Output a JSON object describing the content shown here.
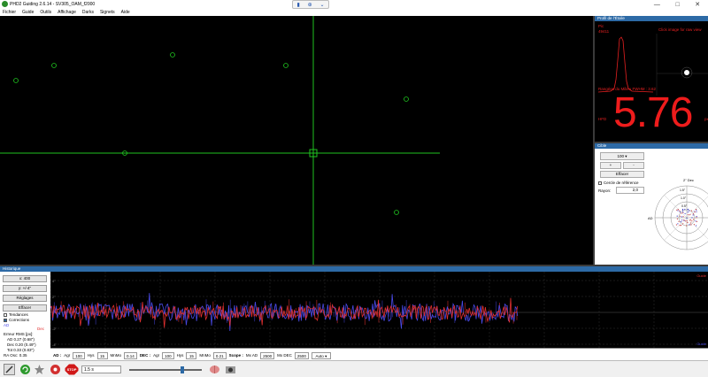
{
  "window": {
    "title": "PHD2 Guiding 2.6.14 - SV305_OAM_f2000",
    "controls": [
      "—",
      "□",
      "✕"
    ]
  },
  "menu": [
    "Fichier",
    "Guide",
    "Outils",
    "Affichage",
    "Darks",
    "Signets",
    "Aide"
  ],
  "star_profile": {
    "header": "Profil de l'Étoile",
    "peak_label": "Pic",
    "peak_value": "49411",
    "click_hint": "Click image for raw view",
    "fwhm_label": "Rangées du Milieu FWHM : 3.62",
    "hfd_label": "HFD",
    "hfd_value": "5.76",
    "hfd_unit": "px"
  },
  "target": {
    "header": "Cible",
    "zoom": "100",
    "plus": "+",
    "minus": "-",
    "clear": "Effacer",
    "ref_circle": "Cercle de référence",
    "radius_label": "Rayon:",
    "radius_value": "2,0",
    "axis_ad": "AD",
    "axis_dec": "2\" Dec",
    "ring_labels": [
      "1.5\"",
      "1.0\"",
      "0.5\""
    ]
  },
  "history": {
    "header": "Historique",
    "x_label": "x: 400",
    "y_label": "y: +/-4\"",
    "settings": "Réglages",
    "clear": "Effacer",
    "trends": "Tendances",
    "corrections": "Corrections",
    "legend_ad": "AD",
    "legend_dec": "Dec",
    "rms_title": "Erreur RMS [px]:",
    "rms_ad": "AD 0.27 (0.68\")",
    "rms_dec": "Dec 0.20 (0.49\")",
    "rms_tot": "Tot 0.33 (0.83\")",
    "osc": "RA Osc: 0.35",
    "y_ticks": [
      "4\"",
      "2\"",
      "0",
      "-2\"",
      "-4\""
    ],
    "right_top": "Guide",
    "right_bottom": "Guide"
  },
  "params": {
    "ad_label": "AD :",
    "agr_label": "Agr",
    "ad_agr": "100",
    "hys_label": "Hys",
    "ad_hys": "15",
    "mnmo_label": "MnMo",
    "ad_mnmo": "0.14",
    "dec_label": "DEC :",
    "dec_agr": "100",
    "dec_hys": "15",
    "dec_mnmo": "0.21",
    "scope_label": "Scope :",
    "mx_ad_label": "Mx AD",
    "mx_ad": "2500",
    "mx_dec_label": "Mx DEC",
    "mx_dec": "2500",
    "mode": "Auto"
  },
  "toolbar": {
    "exposure": "1.5 s",
    "stop_label": "STOP"
  },
  "colors": {
    "ra": "#e23030",
    "dec": "#4a4ae8",
    "grid": "#2a2a2a",
    "accent": "#2d6aa6"
  }
}
